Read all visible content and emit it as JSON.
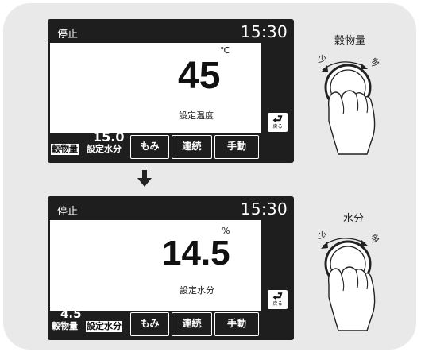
{
  "screens": [
    {
      "status": "停止",
      "time": "15:30",
      "main_value": "45",
      "main_unit": "℃",
      "main_label": "設定温度",
      "info_value": "15.0",
      "info_unit": "%",
      "info_label": "設定水分",
      "mode_tag": "穀物量",
      "back_arrow": "⮐",
      "back_label": "戻る",
      "softkeys": [
        "もみ",
        "連続",
        "手動"
      ]
    },
    {
      "status": "停止",
      "time": "15:30",
      "main_value": "14.5",
      "main_unit": "%",
      "main_label": "設定水分",
      "info_value": "4.5",
      "info_label": "穀物量",
      "mode_tag": "設定水分",
      "back_arrow": "⮐",
      "back_label": "戻る",
      "softkeys": [
        "もみ",
        "連続",
        "手動"
      ]
    }
  ],
  "dials": [
    {
      "title": "穀物量",
      "min": "少",
      "max": "多"
    },
    {
      "title": "水分",
      "min": "少",
      "max": "多"
    }
  ],
  "colors": {
    "panel_bg": "#e9e9ea",
    "screen_bg": "#1e1e1e",
    "display_bg": "#ffffff"
  },
  "icons": {
    "back": "return-arrow-icon",
    "transition": "down-arrow-icon",
    "dial": "rotary-knob-icon"
  }
}
